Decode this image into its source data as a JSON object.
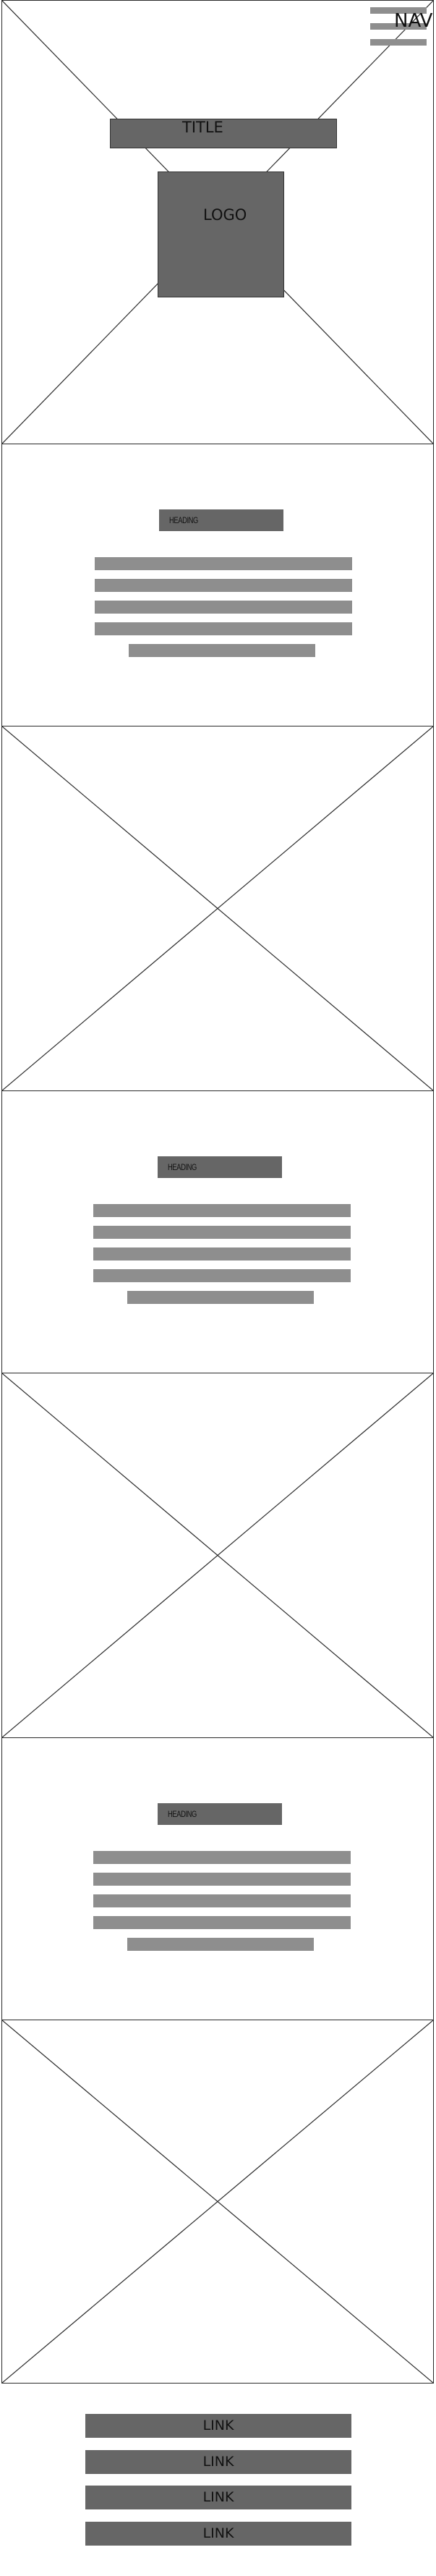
{
  "header": {
    "nav_label": "NAV",
    "title_label": "TITLE",
    "logo_label": "LOGO"
  },
  "sections": [
    {
      "heading": "HEADING"
    },
    {
      "heading": "HEADING"
    },
    {
      "heading": "HEADING"
    }
  ],
  "footer": {
    "links": [
      "LINK",
      "LINK",
      "LINK",
      "LINK"
    ]
  },
  "colors": {
    "placeholder_dark": "#666666",
    "placeholder_light": "#8e8e8e",
    "line": "#2a2a2a",
    "background": "#ffffff"
  }
}
